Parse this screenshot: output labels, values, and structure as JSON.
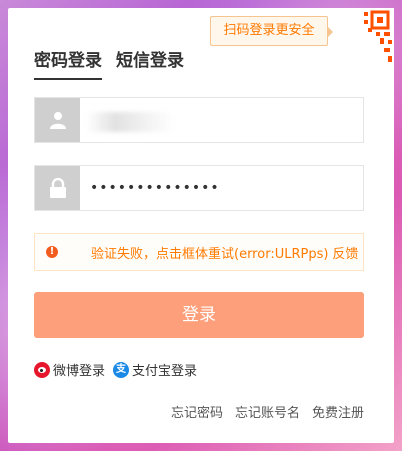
{
  "qr_tip": {
    "label": "扫码登录更安全"
  },
  "tabs": [
    {
      "label": "密码登录",
      "active": true
    },
    {
      "label": "短信登录",
      "active": false
    }
  ],
  "username": {
    "value": ""
  },
  "password": {
    "value": "••••••••••••••"
  },
  "error": {
    "icon": "!",
    "message": "验证失败，点击框体重试(error:ULRPps)",
    "feedback_label": "反馈"
  },
  "login_button": {
    "label": "登录"
  },
  "social": {
    "weibo_label": "微博登录",
    "alipay_icon_glyph": "支",
    "alipay_label": "支付宝登录"
  },
  "links": {
    "forgot_password": "忘记密码",
    "forgot_account": "忘记账号名",
    "register": "免费注册"
  },
  "colors": {
    "accent_orange": "#ff7a00",
    "login_button": "#fd9f7a",
    "error_icon": "#f25c1f",
    "weibo": "#e6162d",
    "alipay": "#1a8ae6"
  }
}
